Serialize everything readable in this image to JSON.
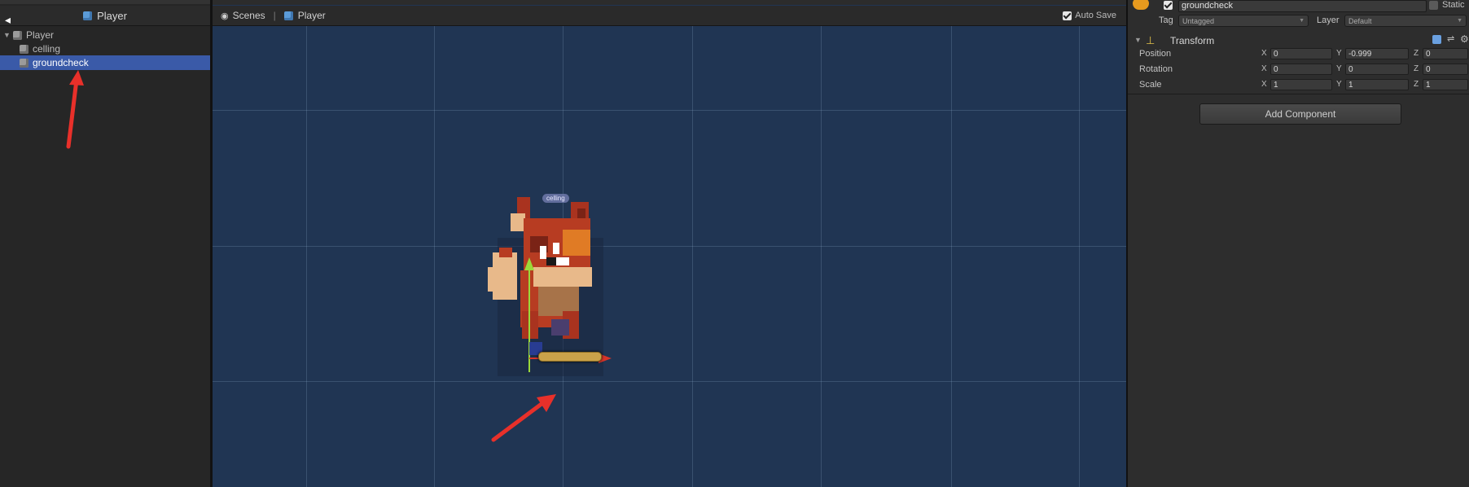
{
  "hierarchy": {
    "breadcrumb": "Player",
    "items": [
      {
        "label": "Player",
        "depth": 0,
        "expanded": true,
        "selected": false
      },
      {
        "label": "celling",
        "depth": 1,
        "expanded": false,
        "selected": false
      },
      {
        "label": "groundcheck",
        "depth": 1,
        "expanded": false,
        "selected": true
      }
    ]
  },
  "scene": {
    "scenes_label": "Scenes",
    "breadcrumb": "Player",
    "auto_save_label": "Auto Save",
    "auto_save_checked": true,
    "object_label": "celling"
  },
  "inspector": {
    "object_name": "groundcheck",
    "active": true,
    "static_label": "Static",
    "tag_label": "Tag",
    "tag_value": "Untagged",
    "layer_label": "Layer",
    "layer_value": "Default",
    "component_title": "Transform",
    "rows": [
      {
        "label": "Position",
        "x": "0",
        "y": "-0.999",
        "z": "0"
      },
      {
        "label": "Rotation",
        "x": "0",
        "y": "0",
        "z": "0"
      },
      {
        "label": "Scale",
        "x": "1",
        "y": "1",
        "z": "1"
      }
    ],
    "axis_labels": {
      "x": "X",
      "y": "Y",
      "z": "Z"
    },
    "add_component_label": "Add Component"
  },
  "colors": {
    "scene_bg": "#203553",
    "selection": "#3a5aa8",
    "annotation": "#e8302a"
  }
}
